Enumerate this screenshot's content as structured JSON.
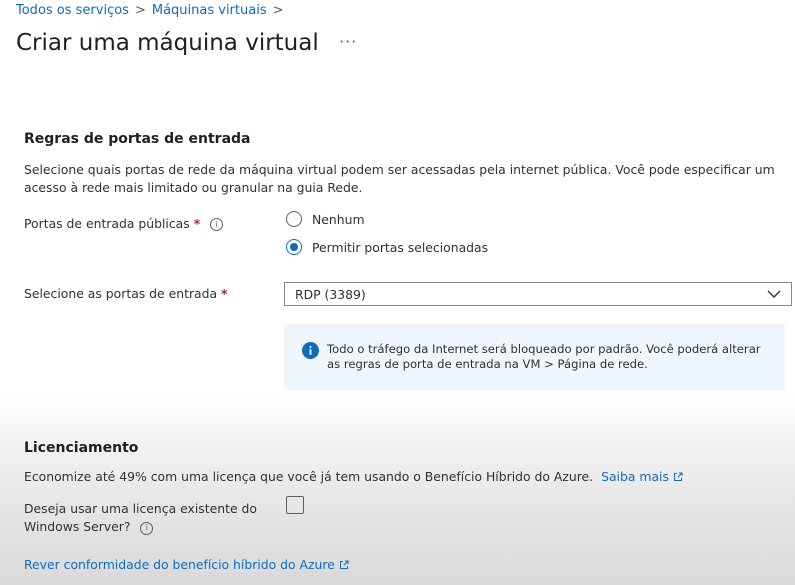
{
  "breadcrumb": {
    "items": [
      "Todos os serviços",
      "Máquinas virtuais"
    ],
    "separator": ">"
  },
  "header": {
    "title": "Criar uma máquina virtual",
    "more": "···"
  },
  "inbound": {
    "heading": "Regras de portas de entrada",
    "description": "Selecione quais portas de rede da máquina virtual podem ser acessadas pela internet pública. Você pode especificar um acesso à rede mais limitado ou granular na guia Rede.",
    "public_ports_label": "Portas de entrada públicas",
    "required_mark": "*",
    "options": [
      {
        "label": "Nenhum",
        "selected": false
      },
      {
        "label": "Permitir portas selecionadas",
        "selected": true
      }
    ],
    "select_ports_label": "Selecione as portas de entrada",
    "select_value": "RDP (3389)",
    "info_message": "Todo o tráfego da Internet será bloqueado por padrão. Você poderá alterar as regras de porta de entrada na VM > Página de rede."
  },
  "licensing": {
    "heading": "Licenciamento",
    "description": "Economize até 49% com uma licença que você já tem usando o Benefício Híbrido do Azure.",
    "learn_more": "Saiba mais",
    "existing_license_label": "Deseja usar uma licença existente do Windows Server?",
    "existing_license_checked": false,
    "compliance_link": "Rever conformidade do benefício híbrido do Azure"
  },
  "colors": {
    "accent": "#0f6cbd",
    "required": "#a4262c",
    "info_bg": "#eff6fc"
  }
}
